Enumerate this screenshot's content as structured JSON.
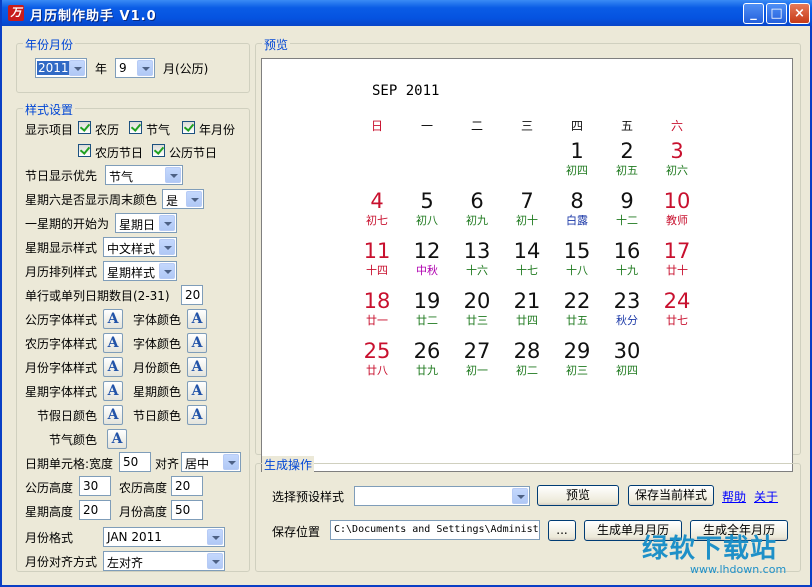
{
  "window": {
    "title": "月历制作助手 V1.0",
    "min_label": "_",
    "max_label": "□",
    "close_label": "×"
  },
  "year_month": {
    "group_title": "年份月份",
    "year_value": "2011",
    "year_suffix": "年",
    "month_value": "9",
    "month_suffix": "月(公历)"
  },
  "style_settings": {
    "group_title": "样式设置",
    "display_items_label": "显示项目",
    "checkboxes": {
      "lunar": "农历",
      "solar_term": "节气",
      "year_month": "年月份",
      "lunar_festival": "农历节日",
      "solar_festival": "公历节日"
    },
    "festival_priority_label": "节日显示优先",
    "festival_priority_value": "节气",
    "saturday_weekend_label": "星期六是否显示周末颜色",
    "saturday_weekend_value": "是",
    "week_start_label": "一星期的开始为",
    "week_start_value": "星期日",
    "week_style_label": "星期显示样式",
    "week_style_value": "中文样式",
    "arrangement_label": "月历排列样式",
    "arrangement_value": "星期样式",
    "dates_per_row_label": "单行或单列日期数目(2-31)",
    "dates_per_row_value": "20",
    "font_buttons": {
      "solar_font": "公历字体样式",
      "font_color": "字体颜色",
      "lunar_font": "农历字体样式",
      "lunar_color": "字体颜色",
      "month_font": "月份字体样式",
      "month_color": "月份颜色",
      "week_font": "星期字体样式",
      "week_color": "星期颜色",
      "holiday_color": "节假日颜色",
      "festival_color": "节日颜色",
      "term_color": "节气颜色",
      "icon_glyph": "A"
    },
    "cell_label": "日期单元格:宽度",
    "cell_width": "50",
    "align_label": "对齐",
    "align_value": "居中",
    "solar_height_label": "公历高度",
    "solar_height": "30",
    "lunar_height_label": "农历高度",
    "lunar_height": "20",
    "week_height_label": "星期高度",
    "week_height": "20",
    "month_height_label": "月份高度",
    "month_height": "50",
    "month_format_label": "月份格式",
    "month_format_value": "JAN 2011",
    "month_align_label": "月份对齐方式",
    "month_align_value": "左对齐"
  },
  "preview": {
    "group_title": "预览",
    "calendar_title": "SEP 2011",
    "weekdays": [
      "日",
      "一",
      "二",
      "三",
      "四",
      "五",
      "六"
    ],
    "weeks": [
      [
        null,
        null,
        null,
        null,
        {
          "d": "1",
          "l": "初四",
          "c": "green"
        },
        {
          "d": "2",
          "l": "初五",
          "c": "green"
        },
        {
          "d": "3",
          "l": "初六",
          "c": "green",
          "r": true
        }
      ],
      [
        {
          "d": "4",
          "l": "初七",
          "c": "red",
          "r": true
        },
        {
          "d": "5",
          "l": "初八",
          "c": "green"
        },
        {
          "d": "6",
          "l": "初九",
          "c": "green"
        },
        {
          "d": "7",
          "l": "初十",
          "c": "green"
        },
        {
          "d": "8",
          "l": "白露",
          "c": "blue"
        },
        {
          "d": "9",
          "l": "十二",
          "c": "green"
        },
        {
          "d": "10",
          "l": "教师",
          "c": "red",
          "r": true
        }
      ],
      [
        {
          "d": "11",
          "l": "十四",
          "c": "red",
          "r": true
        },
        {
          "d": "12",
          "l": "中秋",
          "c": "purple"
        },
        {
          "d": "13",
          "l": "十六",
          "c": "green"
        },
        {
          "d": "14",
          "l": "十七",
          "c": "green"
        },
        {
          "d": "15",
          "l": "十八",
          "c": "green"
        },
        {
          "d": "16",
          "l": "十九",
          "c": "green"
        },
        {
          "d": "17",
          "l": "廿十",
          "c": "red",
          "r": true
        }
      ],
      [
        {
          "d": "18",
          "l": "廿一",
          "c": "red",
          "r": true
        },
        {
          "d": "19",
          "l": "廿二",
          "c": "green"
        },
        {
          "d": "20",
          "l": "廿三",
          "c": "green"
        },
        {
          "d": "21",
          "l": "廿四",
          "c": "green"
        },
        {
          "d": "22",
          "l": "廿五",
          "c": "green"
        },
        {
          "d": "23",
          "l": "秋分",
          "c": "blue"
        },
        {
          "d": "24",
          "l": "廿七",
          "c": "red",
          "r": true
        }
      ],
      [
        {
          "d": "25",
          "l": "廿八",
          "c": "red",
          "r": true
        },
        {
          "d": "26",
          "l": "廿九",
          "c": "green"
        },
        {
          "d": "27",
          "l": "初一",
          "c": "green"
        },
        {
          "d": "28",
          "l": "初二",
          "c": "green"
        },
        {
          "d": "29",
          "l": "初三",
          "c": "green"
        },
        {
          "d": "30",
          "l": "初四",
          "c": "green"
        },
        null
      ]
    ]
  },
  "generate": {
    "group_title": "生成操作",
    "preset_label": "选择预设样式",
    "preset_value": "",
    "preview_button": "预览",
    "save_style_button": "保存当前样式",
    "help_link": "帮助",
    "about_link": "关于",
    "save_location_label": "保存位置",
    "save_path": "C:\\Documents and Settings\\Administ",
    "browse_button": "...",
    "single_month_button": "生成单月月历",
    "full_year_button": "生成全年月历"
  },
  "watermark": {
    "main": "绿软下载站",
    "sub": "www.lhdown.com"
  }
}
